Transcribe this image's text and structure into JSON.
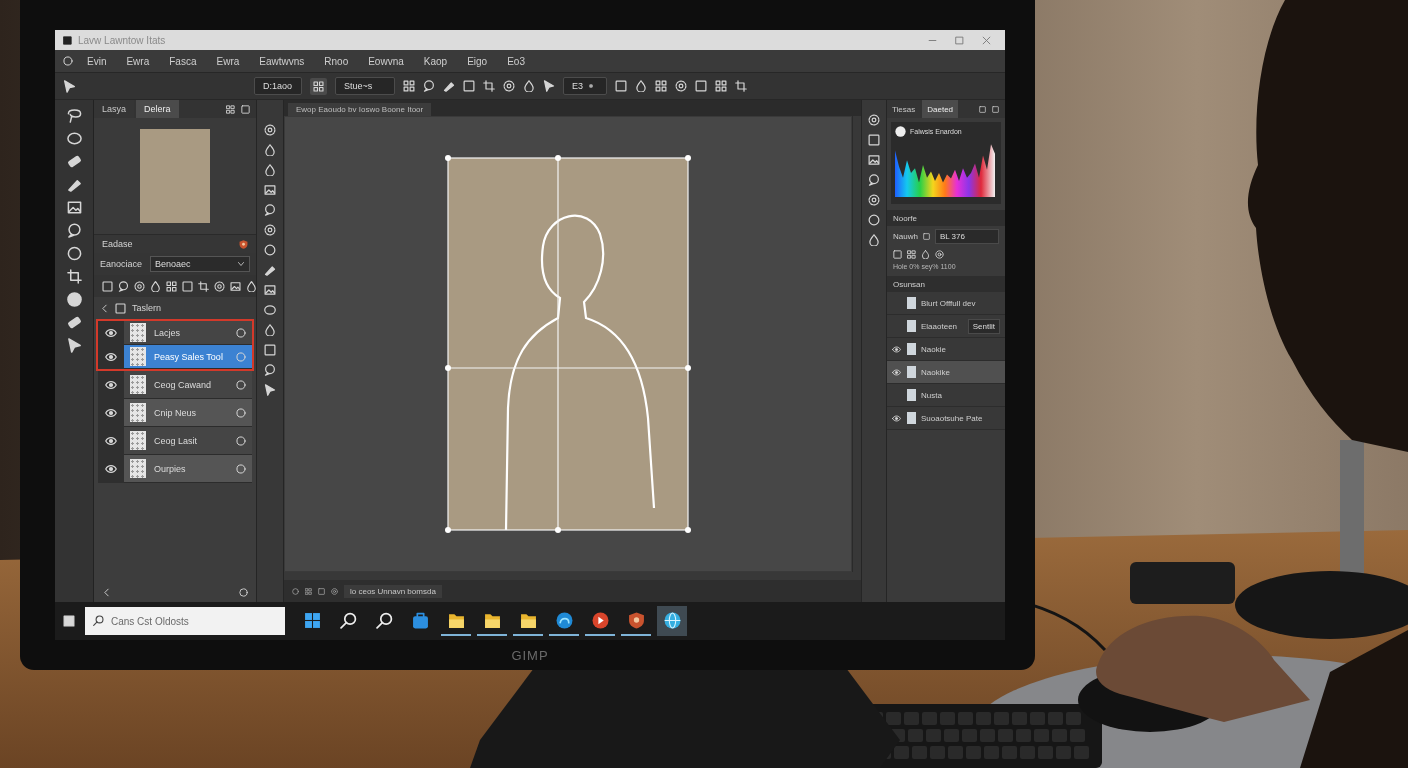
{
  "window": {
    "title": "Lavw Lawntow Itats"
  },
  "menu_bar": {
    "items": [
      "Evin",
      "Ewra",
      "Fasca",
      "Ewra",
      "Eawtwvns",
      "Rnoo",
      "Eowvna",
      "Kaop",
      "Eigo",
      "Eo3"
    ]
  },
  "tool_options": {
    "preset_field": {
      "value": "D:1aoo"
    },
    "mode_dropdown": {
      "value": "Stue~s"
    },
    "size_field": {
      "value": "E3"
    }
  },
  "left_panel": {
    "tabs": [
      {
        "label": "Lasya",
        "selected": false
      },
      {
        "label": "Delera",
        "selected": true
      }
    ],
    "section_title": "Eadase",
    "mode_label": "Eanociace",
    "mode_field": {
      "value": "Benoaec"
    },
    "group": {
      "label": "Taslern",
      "expanded": true
    },
    "layers": [
      {
        "name": "Lacjes",
        "visible": true,
        "selected": false,
        "highlighted": true
      },
      {
        "name": "Peasy Sales Tool",
        "visible": true,
        "selected": true,
        "highlighted": true
      },
      {
        "name": "Ceog Cawand",
        "visible": true,
        "selected": false,
        "highlighted": false
      },
      {
        "name": "Cnip Neus",
        "visible": true,
        "selected": false,
        "highlighted": false
      },
      {
        "name": "Ceog Lasit",
        "visible": true,
        "selected": false,
        "highlighted": false
      },
      {
        "name": "Ourpies",
        "visible": true,
        "selected": false,
        "highlighted": false
      }
    ]
  },
  "document": {
    "tab_title": "Ewop Eaoudo bv Ioswo Boone Itoor"
  },
  "canvas": {
    "crop_grid": true,
    "selection_outline": true
  },
  "status_bar": {
    "text": "lo ceos Unnavn bomsda"
  },
  "right_panel": {
    "tabs": [
      {
        "label": "Tiesas",
        "selected": false
      },
      {
        "label": "Daeted",
        "selected": true
      }
    ],
    "histogram_label": "Falwsis Enardon",
    "properties": {
      "title": "Noorfe",
      "field_label": "Nauwh",
      "field_value": "BL 376",
      "info": "Hole 0% sey% 1100"
    },
    "adjustments": {
      "title": "Osunsan",
      "rows": [
        {
          "label": "Blurt Offfull dev",
          "visible": false,
          "selected": false
        },
        {
          "label": "Elaaoteen",
          "value": "Sentlit",
          "visible": false,
          "selected": false
        },
        {
          "label": "Naokie",
          "visible": true,
          "selected": false
        },
        {
          "label": "Naokike",
          "visible": true,
          "selected": true
        },
        {
          "label": "Nusta",
          "visible": false,
          "selected": false
        },
        {
          "label": "Suoaotsuhe Pate",
          "visible": true,
          "selected": false
        }
      ]
    }
  },
  "taskbar": {
    "search_placeholder": "Cans Cst Oldosts",
    "apps": [
      {
        "kind": "start",
        "running": false,
        "active": false
      },
      {
        "kind": "search",
        "running": false,
        "active": false
      },
      {
        "kind": "search",
        "running": false,
        "active": false
      },
      {
        "kind": "store",
        "running": false,
        "active": false
      },
      {
        "kind": "folder",
        "running": true,
        "active": false
      },
      {
        "kind": "folder",
        "running": true,
        "active": false
      },
      {
        "kind": "folder",
        "running": true,
        "active": false
      },
      {
        "kind": "browser",
        "running": true,
        "active": false
      },
      {
        "kind": "media",
        "running": true,
        "active": false
      },
      {
        "kind": "shield",
        "running": true,
        "active": false
      },
      {
        "kind": "globe",
        "running": false,
        "active": true
      }
    ]
  },
  "monitor": {
    "brand": "GIMP"
  }
}
